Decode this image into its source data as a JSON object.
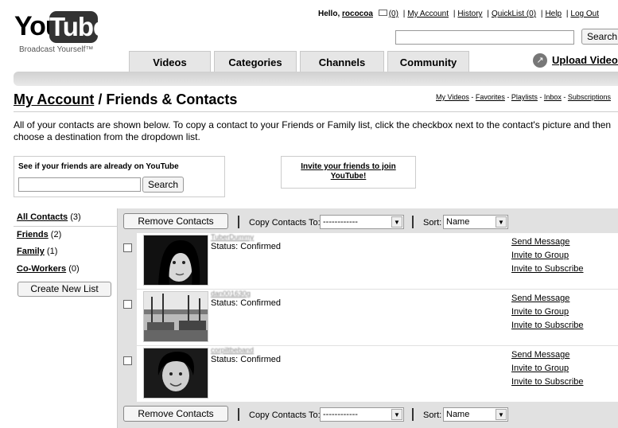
{
  "brand": {
    "logo_left": "You",
    "logo_right": "Tube",
    "tagline": "Broadcast Yourself™"
  },
  "user_bar": {
    "greeting": "Hello,",
    "username": "rococoa",
    "inbox_count": "(0)",
    "links": [
      "My Account",
      "History",
      "QuickList (0)",
      "Help",
      "Log Out"
    ]
  },
  "search": {
    "placeholder": "",
    "button": "Search"
  },
  "tabs": [
    "Videos",
    "Categories",
    "Channels",
    "Community"
  ],
  "upload": {
    "label": "Upload Videos"
  },
  "page": {
    "breadcrumb_root": "My Account",
    "breadcrumb_sep": "/",
    "title": "Friends & Contacts",
    "sublinks": [
      "My Videos",
      "Favorites",
      "Playlists",
      "Inbox",
      "Subscriptions"
    ],
    "intro": "All of your contacts are shown below. To copy a contact to your Friends or Family list, click the checkbox next to the contact's picture and then choose a destination from the dropdown list."
  },
  "find_friends": {
    "label": "See if your friends are already on YouTube",
    "button": "Search",
    "value": ""
  },
  "invite": {
    "line1": "Invite your friends to join",
    "line2": "YouTube!"
  },
  "lists": [
    {
      "label": "All Contacts",
      "count": "(3)"
    },
    {
      "label": "Friends",
      "count": "(2)"
    },
    {
      "label": "Family",
      "count": "(1)"
    },
    {
      "label": "Co-Workers",
      "count": "(0)"
    }
  ],
  "create_list_button": "Create New List",
  "toolbar": {
    "remove_button": "Remove Contacts",
    "copy_label": "Copy Contacts To:",
    "copy_value": "------------",
    "sort_label": "Sort:",
    "sort_value": "Name"
  },
  "contacts": [
    {
      "name": "TuberDummy",
      "status": "Status: Confirmed",
      "actions": [
        "Send Message",
        "Invite to Group",
        "Invite to Subscribe"
      ]
    },
    {
      "name": "dan001630g",
      "status": "Status: Confirmed",
      "actions": [
        "Send Message",
        "Invite to Group",
        "Invite to Subscribe"
      ]
    },
    {
      "name": "corpiltbeband",
      "status": "Status: Confirmed",
      "actions": [
        "Send Message",
        "Invite to Group",
        "Invite to Subscribe"
      ]
    }
  ],
  "icons": {
    "mail": "envelope-icon",
    "upload": "upload-arrow-icon",
    "dropdown": "chevron-down-icon"
  },
  "colors": {
    "panel_bg": "#e1e1e1",
    "tab_bg": "#e6e6e6",
    "logo_box": "#333333"
  }
}
